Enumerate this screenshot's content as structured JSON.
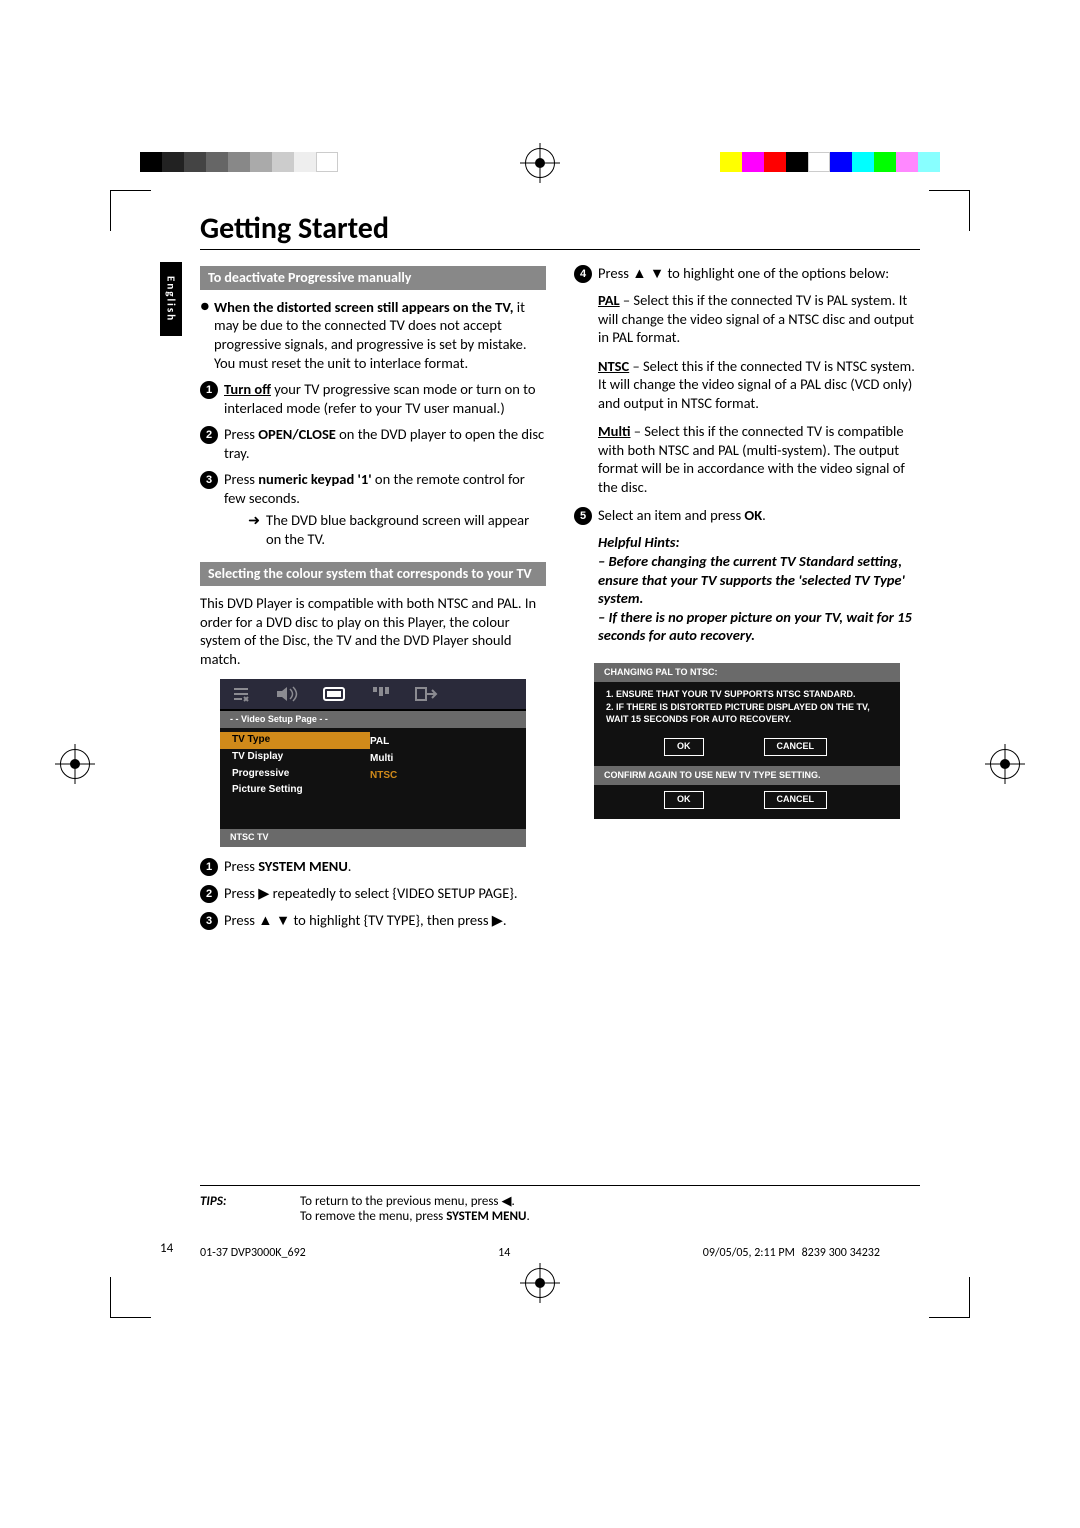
{
  "title": "Getting Started",
  "language_tab": "English",
  "left": {
    "section1_title": "To deactivate Progressive manually",
    "bullet_intro_bold": "When the distorted screen still appears on the TV,",
    "bullet_intro_rest": " it may be due to the connected TV does not accept progressive signals, and progressive is set by mistake.  You must reset the unit to interlace format.",
    "step1_lead": "Turn off",
    "step1_rest": " your TV progressive scan mode or turn on to interlaced mode (refer to your TV user manual.)",
    "step2_a": "Press ",
    "step2_b": "OPEN/CLOSE",
    "step2_c": " on the DVD player to open the disc tray.",
    "step3_a": "Press ",
    "step3_b": "numeric keypad '1'",
    "step3_c": " on the remote control for few seconds.",
    "step3_sub": "The DVD blue background screen will appear on the TV.",
    "section2_title": "Selecting the colour system that corresponds to your TV",
    "section2_intro": "This DVD Player is compatible with both NTSC and PAL. In order for a DVD disc to play on this Player, the colour system of the Disc, the TV and the DVD Player should match.",
    "osd": {
      "pagebar": "- -   Video Setup Page   - -",
      "rows": [
        {
          "k": "TV Type",
          "v": "PAL",
          "sel": true
        },
        {
          "k": "TV Display",
          "v": ""
        },
        {
          "k": "Progressive",
          "v": ""
        },
        {
          "k": "Picture Setting",
          "v": ""
        }
      ],
      "opts": [
        "PAL",
        "Multi",
        "NTSC"
      ],
      "opt_sel_index": 2,
      "footer": "NTSC TV"
    },
    "s2_step1_a": "Press ",
    "s2_step1_b": "SYSTEM MENU",
    "s2_step1_c": ".",
    "s2_step2": "Press ▶ repeatedly to select {VIDEO SETUP PAGE}.",
    "s2_step3": "Press ▲ ▼ to highlight {TV TYPE}, then press ▶."
  },
  "right": {
    "step4": "Press ▲ ▼ to highlight one of the options below:",
    "pal_label": "PAL",
    "pal_text": " – Select this if the connected TV is PAL system. It will change the video signal of a NTSC disc and output in PAL format.",
    "ntsc_label": "NTSC",
    "ntsc_text": " – Select this if the connected TV is NTSC system.  It will change the video signal of a PAL disc (VCD only) and output in NTSC format.",
    "multi_label": "Multi",
    "multi_text": " – Select this if the connected TV is compatible with both NTSC and PAL (multi-system).  The output format will be in accordance with the video signal of the disc.",
    "step5_a": "Select an item and press ",
    "step5_b": "OK",
    "step5_c": ".",
    "hints_label": "Helpful Hints:",
    "hints_1": "–   Before changing the current TV Standard setting, ensure that your TV supports the 'selected TV Type' system.",
    "hints_2": "–   If there is no proper picture on your TV, wait for 15 seconds for auto recovery.",
    "dialog": {
      "hdr1": "CHANGING PAL TO NTSC:",
      "body1_1": "1. ENSURE THAT YOUR TV SUPPORTS NTSC STANDARD.",
      "body1_2": "2. IF THERE IS DISTORTED PICTURE DISPLAYED ON THE TV, WAIT 15 SECONDS FOR AUTO RECOVERY.",
      "ok": "OK",
      "cancel": "CANCEL",
      "hdr2": "CONFIRM AGAIN TO USE NEW TV TYPE SETTING."
    }
  },
  "tips": {
    "label": "TIPS:",
    "line1": "To return to the previous menu, press ◀.",
    "line2_a": "To remove the menu, press ",
    "line2_b": "SYSTEM MENU",
    "line2_c": "."
  },
  "page_number": "14",
  "footer_left": "01-37 DVP3000K_692",
  "footer_mid": "14",
  "footer_right": "09/05/05, 2:11 PM",
  "part_number": "8239 300 34232"
}
